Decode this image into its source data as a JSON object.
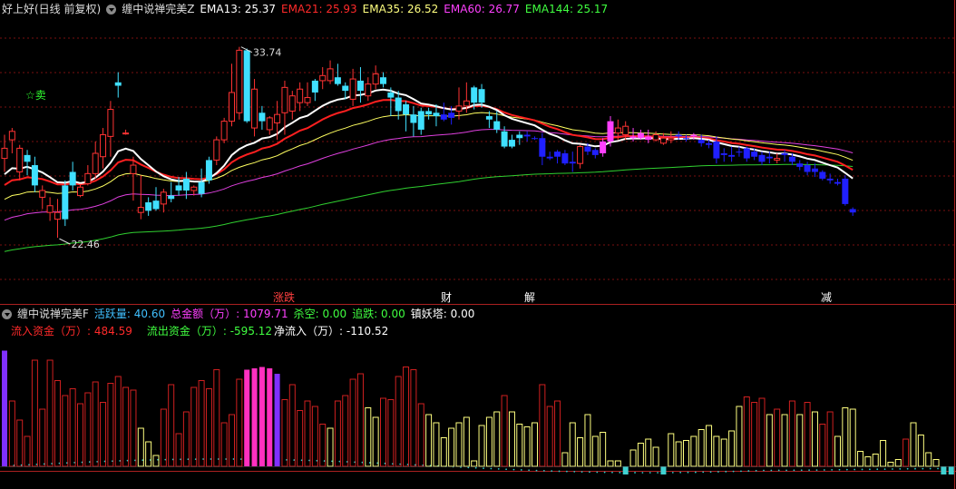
{
  "main_header": {
    "title": "好上好(日线 前复权)",
    "indicator": "缠中说禅完美Z",
    "ema13": {
      "label": "EMA13: 25.37",
      "color": "#ffffff"
    },
    "ema21": {
      "label": "EMA21: 25.93",
      "color": "#ff2a2a"
    },
    "ema35": {
      "label": "EMA35: 26.52",
      "color": "#ffff80"
    },
    "ema60": {
      "label": "EMA60: 26.77",
      "color": "#ff40ff"
    },
    "ema144": {
      "label": "EMA144: 25.17",
      "color": "#40ff40"
    }
  },
  "annotations": {
    "high": "33.74",
    "low": "22.46",
    "sell": "☆卖"
  },
  "bottom_markers": [
    {
      "text": "涨跌",
      "color": "#ff4040",
      "bg": "#ffffff"
    },
    {
      "text": "财",
      "color": "#ffffff",
      "bg": "#3a7cff"
    },
    {
      "text": "解",
      "color": "#ffffff",
      "bg": "#40c0ff"
    },
    {
      "text": "减",
      "color": "#ffffff",
      "bg": "#20c040"
    }
  ],
  "sub_header": {
    "indicator": "缠中说禅完美F",
    "activity": {
      "label": "活跃量: 40.60",
      "color": "#40c0ff"
    },
    "turnover": {
      "label": "总金额（万）: 1079.71",
      "color": "#ff40ff"
    },
    "short_kill": {
      "label": "杀空: 0.00",
      "color": "#40ff40"
    },
    "chase_fall": {
      "label": "追跌: 0.00",
      "color": "#40ff40"
    },
    "demon_tower": {
      "label": "镇妖塔: 0.00",
      "color": "#ffffff"
    }
  },
  "sub_header2": {
    "inflow": {
      "label": "流入资金（万）: 484.59",
      "color": "#ff2a2a"
    },
    "outflow": {
      "label": "流出资金（万）: -595.12",
      "color": "#40ff40"
    },
    "net": {
      "label": "净流入（万）: -110.52",
      "color": "#ffffff"
    }
  },
  "colors": {
    "up": "#ff3333",
    "down_cyan": "#40e0ff",
    "down_blue": "#2020ff",
    "pink": "#ff40ff",
    "ema13": "#ffffff",
    "ema21": "#ff2020",
    "ema35": "#ffff60",
    "ema60": "#e040e0",
    "ema144": "#30d030",
    "vol_red": "#d02020",
    "vol_yellow": "#ffff80",
    "vol_magenta": "#ff30c0",
    "vol_purple": "#8030ff",
    "vol_cyan": "#40d0d0"
  },
  "chart_data": {
    "type": "candlestick",
    "ylim": [
      19.5,
      35.5
    ],
    "ohlc": [
      [
        27.2,
        28.6,
        26.4,
        27.8,
        "u"
      ],
      [
        28.3,
        29.0,
        27.5,
        28.8,
        "u"
      ],
      [
        27.8,
        28.0,
        25.9,
        26.4,
        "u"
      ],
      [
        27.0,
        27.7,
        26.2,
        27.4,
        "c"
      ],
      [
        26.8,
        27.3,
        25.2,
        25.6,
        "c"
      ],
      [
        24.9,
        25.6,
        24.2,
        25.3,
        "u"
      ],
      [
        24.0,
        24.9,
        23.5,
        24.4,
        "u"
      ],
      [
        23.6,
        24.8,
        22.5,
        24.0,
        "u"
      ],
      [
        23.6,
        25.9,
        23.2,
        25.6,
        "c"
      ],
      [
        25.6,
        27.0,
        25.3,
        26.4,
        "c"
      ],
      [
        25.5,
        25.7,
        24.9,
        25.0,
        "u"
      ],
      [
        25.7,
        26.8,
        25.6,
        26.3,
        "u"
      ],
      [
        26.3,
        28.2,
        26.0,
        27.5,
        "u"
      ],
      [
        27.3,
        29.0,
        26.6,
        28.6,
        "u"
      ],
      [
        28.5,
        30.6,
        27.3,
        30.1,
        "u"
      ],
      [
        31.5,
        32.3,
        30.8,
        31.7,
        "c"
      ],
      [
        28.7,
        28.9,
        28.6,
        28.7,
        "u"
      ],
      [
        26.3,
        27.3,
        24.7,
        26.8,
        "u"
      ],
      [
        24.0,
        26.2,
        23.6,
        24.3,
        "u"
      ],
      [
        24.1,
        24.9,
        23.8,
        24.6,
        "c"
      ],
      [
        24.7,
        25.5,
        24.1,
        24.2,
        "c"
      ],
      [
        25.2,
        25.4,
        24.0,
        24.5,
        "u"
      ],
      [
        25.0,
        25.8,
        24.6,
        24.8,
        "c"
      ],
      [
        25.6,
        26.1,
        25.0,
        25.3,
        "c"
      ],
      [
        25.3,
        26.4,
        24.8,
        26.0,
        "c"
      ],
      [
        25.3,
        25.6,
        25.0,
        25.5,
        "u"
      ],
      [
        25.1,
        26.6,
        24.9,
        25.8,
        "c"
      ],
      [
        25.9,
        27.3,
        25.7,
        27.1,
        "c"
      ],
      [
        27.1,
        28.5,
        26.8,
        28.3,
        "u"
      ],
      [
        28.3,
        29.6,
        28.1,
        29.4,
        "u"
      ],
      [
        29.4,
        32.8,
        29.1,
        31.1,
        "u"
      ],
      [
        33.6,
        33.8,
        29.5,
        29.9,
        "u"
      ],
      [
        33.6,
        33.7,
        29.3,
        29.4,
        "c"
      ],
      [
        31.3,
        31.9,
        28.5,
        29.0,
        "u"
      ],
      [
        29.4,
        30.3,
        28.9,
        29.9,
        "c"
      ],
      [
        29.6,
        29.7,
        28.6,
        28.9,
        "u"
      ],
      [
        29.3,
        30.6,
        28.3,
        29.8,
        "u"
      ],
      [
        29.9,
        31.8,
        28.6,
        31.4,
        "u"
      ],
      [
        30.0,
        31.2,
        29.5,
        30.9,
        "u"
      ],
      [
        30.5,
        31.7,
        30.0,
        31.3,
        "u"
      ],
      [
        30.8,
        31.7,
        30.3,
        30.5,
        "u"
      ],
      [
        31.1,
        31.9,
        30.6,
        31.8,
        "c"
      ],
      [
        31.8,
        32.6,
        31.3,
        32.1,
        "u"
      ],
      [
        32.5,
        33.0,
        31.6,
        31.8,
        "u"
      ],
      [
        32.0,
        32.8,
        31.5,
        31.6,
        "c"
      ],
      [
        31.5,
        31.7,
        30.7,
        31.2,
        "c"
      ],
      [
        30.7,
        32.5,
        30.3,
        31.9,
        "u"
      ],
      [
        31.8,
        32.6,
        30.5,
        31.2,
        "c"
      ],
      [
        30.9,
        32.0,
        30.6,
        31.6,
        "u"
      ],
      [
        31.6,
        32.7,
        31.3,
        32.2,
        "u"
      ],
      [
        32.0,
        32.3,
        31.4,
        31.6,
        "c"
      ],
      [
        31.1,
        31.4,
        29.7,
        30.8,
        "c"
      ],
      [
        30.8,
        31.2,
        29.5,
        30.0,
        "c"
      ],
      [
        29.8,
        30.6,
        28.8,
        30.4,
        "c"
      ],
      [
        29.8,
        30.3,
        28.5,
        29.3,
        "c"
      ],
      [
        30.0,
        30.2,
        28.6,
        28.9,
        "c"
      ],
      [
        29.8,
        30.2,
        29.5,
        30.0,
        "c"
      ],
      [
        29.9,
        30.4,
        29.1,
        29.7,
        "c"
      ],
      [
        29.8,
        30.5,
        29.4,
        29.5,
        "b"
      ],
      [
        29.9,
        30.3,
        29.2,
        29.6,
        "b"
      ],
      [
        30.0,
        31.4,
        29.5,
        30.3,
        "u"
      ],
      [
        30.3,
        31.7,
        29.9,
        30.6,
        "u"
      ],
      [
        30.5,
        31.5,
        30.1,
        31.4,
        "c"
      ],
      [
        31.3,
        31.6,
        30.2,
        30.5,
        "c"
      ],
      [
        29.7,
        30.0,
        29.0,
        29.5,
        "c"
      ],
      [
        29.4,
        30.0,
        28.7,
        28.9,
        "c"
      ],
      [
        28.8,
        29.1,
        27.8,
        27.9,
        "c"
      ],
      [
        27.9,
        28.6,
        27.8,
        28.3,
        "c"
      ],
      [
        28.4,
        28.8,
        28.0,
        28.6,
        "c"
      ],
      [
        28.6,
        28.8,
        28.2,
        28.5,
        "b"
      ],
      [
        28.4,
        28.5,
        28.3,
        28.4,
        "b"
      ],
      [
        28.4,
        28.7,
        26.8,
        27.3,
        "b"
      ],
      [
        27.3,
        27.6,
        27.1,
        27.2,
        "b"
      ],
      [
        27.3,
        27.7,
        26.9,
        27.6,
        "b"
      ],
      [
        27.5,
        27.7,
        26.8,
        26.9,
        "b"
      ],
      [
        26.9,
        27.6,
        26.4,
        27.0,
        "b"
      ],
      [
        26.9,
        28.0,
        26.6,
        27.9,
        "u"
      ],
      [
        27.9,
        28.1,
        27.4,
        27.6,
        "b"
      ],
      [
        27.7,
        27.8,
        27.2,
        27.4,
        "b"
      ],
      [
        27.5,
        28.4,
        27.3,
        28.2,
        "p"
      ],
      [
        28.2,
        29.7,
        27.9,
        29.4,
        "p"
      ],
      [
        29.0,
        29.5,
        28.3,
        28.7,
        "u"
      ],
      [
        28.6,
        29.4,
        28.3,
        29.1,
        "u"
      ],
      [
        28.4,
        29.0,
        28.2,
        28.5,
        "p"
      ],
      [
        28.7,
        28.9,
        28.3,
        28.4,
        "p"
      ],
      [
        28.3,
        28.9,
        28.1,
        28.5,
        "p"
      ],
      [
        28.6,
        28.8,
        28.2,
        28.3,
        "u"
      ],
      [
        28.4,
        28.7,
        28.0,
        28.1,
        "u"
      ],
      [
        28.4,
        28.8,
        28.1,
        28.3,
        "u"
      ],
      [
        28.6,
        28.8,
        28.3,
        28.5,
        "b"
      ],
      [
        28.4,
        28.6,
        28.2,
        28.4,
        "b"
      ],
      [
        28.5,
        28.7,
        28.3,
        28.6,
        "p"
      ],
      [
        28.3,
        28.6,
        27.9,
        28.1,
        "b"
      ],
      [
        28.1,
        28.3,
        27.8,
        28.0,
        "b"
      ],
      [
        28.2,
        28.5,
        26.9,
        27.2,
        "b"
      ],
      [
        27.5,
        27.8,
        27.0,
        27.4,
        "b"
      ],
      [
        27.4,
        27.9,
        27.0,
        27.3,
        "b"
      ],
      [
        27.6,
        27.9,
        27.3,
        27.6,
        "b"
      ],
      [
        27.8,
        27.9,
        27.0,
        27.2,
        "b"
      ],
      [
        27.6,
        27.8,
        27.1,
        27.3,
        "b"
      ],
      [
        27.4,
        27.6,
        26.8,
        27.0,
        "b"
      ],
      [
        27.3,
        27.6,
        26.9,
        27.2,
        "b"
      ],
      [
        27.2,
        27.5,
        26.9,
        27.1,
        "u"
      ],
      [
        27.4,
        27.7,
        27.0,
        27.5,
        "b"
      ],
      [
        27.3,
        27.5,
        26.8,
        27.0,
        "b"
      ],
      [
        26.9,
        27.1,
        26.5,
        26.7,
        "b"
      ],
      [
        26.8,
        27.0,
        26.2,
        26.4,
        "b"
      ],
      [
        26.4,
        26.9,
        26.1,
        26.6,
        "b"
      ],
      [
        26.4,
        26.5,
        25.9,
        26.0,
        "b"
      ],
      [
        26.0,
        26.3,
        25.7,
        25.9,
        "b"
      ],
      [
        25.7,
        26.0,
        25.6,
        25.8,
        "b"
      ],
      [
        26.0,
        26.2,
        24.4,
        24.5,
        "b"
      ],
      [
        24.2,
        24.3,
        23.8,
        24.0,
        "b"
      ]
    ],
    "volume": [
      [
        0.85,
        "p"
      ],
      [
        0.48,
        "r"
      ],
      [
        0.34,
        "r"
      ],
      [
        0.22,
        "r"
      ],
      [
        0.78,
        "r"
      ],
      [
        0.42,
        "r"
      ],
      [
        0.78,
        "r"
      ],
      [
        0.63,
        "r"
      ],
      [
        0.52,
        "r"
      ],
      [
        0.57,
        "r"
      ],
      [
        0.46,
        "r"
      ],
      [
        0.54,
        "r"
      ],
      [
        0.62,
        "r"
      ],
      [
        0.47,
        "r"
      ],
      [
        0.61,
        "r"
      ],
      [
        0.66,
        "r"
      ],
      [
        0.58,
        "r"
      ],
      [
        0.56,
        "r"
      ],
      [
        0.28,
        "y"
      ],
      [
        0.18,
        "y"
      ],
      [
        0.08,
        "y"
      ],
      [
        0.42,
        "r"
      ],
      [
        0.6,
        "r"
      ],
      [
        0.24,
        "r"
      ],
      [
        0.4,
        "r"
      ],
      [
        0.58,
        "r"
      ],
      [
        0.63,
        "r"
      ],
      [
        0.57,
        "r"
      ],
      [
        0.71,
        "r"
      ],
      [
        0.32,
        "r"
      ],
      [
        0.38,
        "r"
      ],
      [
        0.64,
        "r"
      ],
      [
        0.71,
        "m"
      ],
      [
        0.72,
        "m"
      ],
      [
        0.73,
        "m"
      ],
      [
        0.72,
        "m"
      ],
      [
        0.68,
        "p"
      ],
      [
        0.49,
        "r"
      ],
      [
        0.6,
        "r"
      ],
      [
        0.41,
        "r"
      ],
      [
        0.48,
        "r"
      ],
      [
        0.44,
        "r"
      ],
      [
        0.31,
        "r"
      ],
      [
        0.28,
        "y"
      ],
      [
        0.48,
        "r"
      ],
      [
        0.52,
        "r"
      ],
      [
        0.64,
        "r"
      ],
      [
        0.68,
        "r"
      ],
      [
        0.43,
        "y"
      ],
      [
        0.36,
        "y"
      ],
      [
        0.5,
        "r"
      ],
      [
        0.49,
        "r"
      ],
      [
        0.66,
        "r"
      ],
      [
        0.73,
        "r"
      ],
      [
        0.71,
        "r"
      ],
      [
        0.46,
        "r"
      ],
      [
        0.38,
        "y"
      ],
      [
        0.32,
        "y"
      ],
      [
        0.21,
        "y"
      ],
      [
        0.28,
        "y"
      ],
      [
        0.32,
        "y"
      ],
      [
        0.36,
        "y"
      ],
      [
        0.04,
        "y"
      ],
      [
        0.3,
        "y"
      ],
      [
        0.36,
        "y"
      ],
      [
        0.4,
        "y"
      ],
      [
        0.52,
        "r"
      ],
      [
        0.4,
        "y"
      ],
      [
        0.31,
        "y"
      ],
      [
        0.29,
        "y"
      ],
      [
        0.32,
        "y"
      ],
      [
        0.6,
        "r"
      ],
      [
        0.44,
        "r"
      ],
      [
        0.48,
        "r"
      ],
      [
        0.1,
        "y"
      ],
      [
        0.32,
        "y"
      ],
      [
        0.21,
        "y"
      ],
      [
        0.38,
        "y"
      ],
      [
        0.22,
        "y"
      ],
      [
        0.25,
        "y"
      ],
      [
        0.04,
        "y"
      ],
      [
        0.04,
        "y"
      ],
      [
        -0.06,
        "c"
      ],
      [
        0.12,
        "y"
      ],
      [
        0.17,
        "y"
      ],
      [
        0.2,
        "y"
      ],
      [
        0.14,
        "y"
      ],
      [
        -0.06,
        "c"
      ],
      [
        0.24,
        "y"
      ],
      [
        0.18,
        "y"
      ],
      [
        0.19,
        "y"
      ],
      [
        0.22,
        "y"
      ],
      [
        0.27,
        "y"
      ],
      [
        0.3,
        "y"
      ],
      [
        0.22,
        "y"
      ],
      [
        0.2,
        "y"
      ],
      [
        0.26,
        "y"
      ],
      [
        0.44,
        "y"
      ],
      [
        0.51,
        "r"
      ],
      [
        0.47,
        "r"
      ],
      [
        0.5,
        "r"
      ],
      [
        0.38,
        "y"
      ],
      [
        0.42,
        "r"
      ],
      [
        0.38,
        "y"
      ],
      [
        0.48,
        "r"
      ],
      [
        0.38,
        "y"
      ],
      [
        0.47,
        "r"
      ],
      [
        0.4,
        "y"
      ],
      [
        0.31,
        "r"
      ],
      [
        0.4,
        "r"
      ],
      [
        0.22,
        "y"
      ],
      [
        0.43,
        "y"
      ],
      [
        0.42,
        "y"
      ],
      [
        0.11,
        "y"
      ],
      [
        0.07,
        "y"
      ],
      [
        0.09,
        "y"
      ],
      [
        0.19,
        "y"
      ],
      [
        0.03,
        "y"
      ],
      [
        0.05,
        "y"
      ],
      [
        0.2,
        "r"
      ],
      [
        0.32,
        "y"
      ],
      [
        0.23,
        "y"
      ],
      [
        0.1,
        "y"
      ],
      [
        0.05,
        "y"
      ],
      [
        -0.06,
        "c"
      ],
      [
        -0.06,
        "c"
      ],
      [
        -0.05,
        "c"
      ],
      [
        -0.06,
        "c"
      ]
    ]
  }
}
